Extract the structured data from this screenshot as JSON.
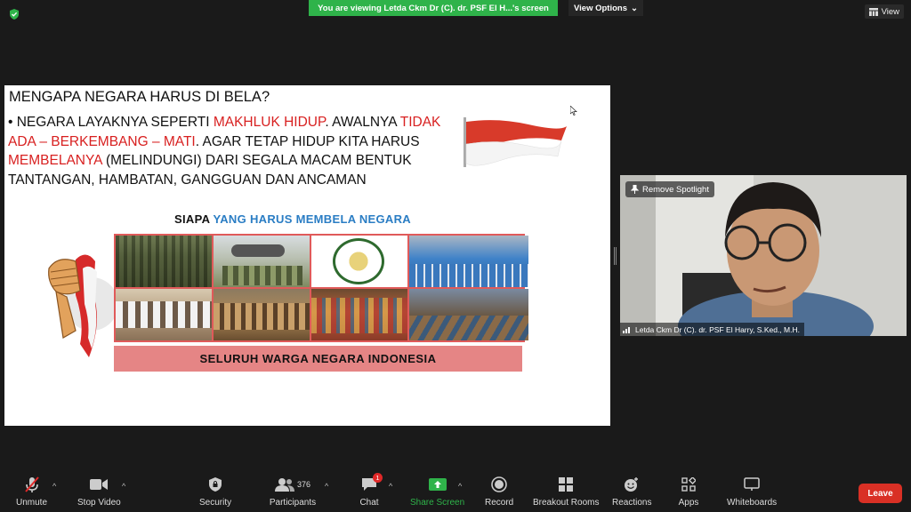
{
  "top": {
    "viewing_banner": "You are viewing Letda Ckm Dr (C). dr. PSF El H...'s screen",
    "view_options": "View Options",
    "view": "View"
  },
  "slide": {
    "title": "MENGAPA NEGARA HARUS DI BELA?",
    "bullet_parts": [
      "NEGARA LAYAKNYA SEPERTI ",
      "MAKHLUK HIDUP",
      ". AWALNYA ",
      "TIDAK ADA – BERKEMBANG – MATI",
      ". AGAR TETAP HIDUP KITA HARUS ",
      "MEMBELANYA",
      " (MELINDUNGI) DARI SEGALA MACAM BENTUK TANTANGAN, HAMBATAN, GANGGUAN DAN ANCAMAN"
    ],
    "siapa_prefix": "SIAPA ",
    "siapa_highlight": "YANG HARUS MEMBELA NEGARA",
    "banner": "SELURUH WARGA NEGARA INDONESIA",
    "accent_red": "#d82020",
    "accent_blue": "#2a7dc4"
  },
  "video": {
    "remove_spotlight": "Remove Spotlight",
    "participant_name": "Letda Ckm Dr (C). dr. PSF El Harry, S.Ked., M.H."
  },
  "toolbar": {
    "unmute": "Unmute",
    "stop_video": "Stop Video",
    "security": "Security",
    "participants": "Participants",
    "participants_count": "376",
    "chat": "Chat",
    "chat_badge": "1",
    "share_screen": "Share Screen",
    "record": "Record",
    "breakout_rooms": "Breakout Rooms",
    "reactions": "Reactions",
    "apps": "Apps",
    "whiteboards": "Whiteboards",
    "leave": "Leave",
    "share_color": "#2fb34a",
    "leave_color": "#d93025"
  }
}
